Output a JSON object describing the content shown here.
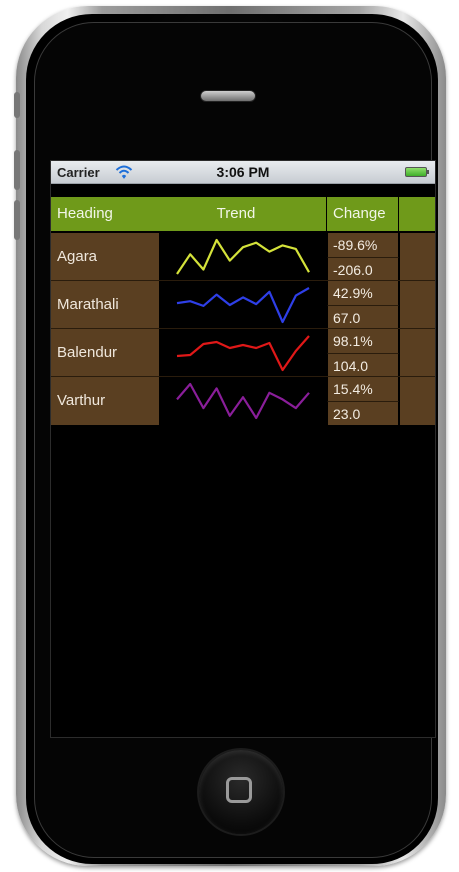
{
  "status_bar": {
    "carrier": "Carrier",
    "time": "3:06 PM",
    "wifi_icon": "wifi-icon",
    "battery_icon": "battery-icon"
  },
  "table": {
    "headers": {
      "heading": "Heading",
      "trend": "Trend",
      "change": "Change"
    },
    "rows": [
      {
        "name": "Agara",
        "change_percent": "-89.6%",
        "change_value": "-206.0",
        "trend_color": "#d4e23a",
        "trend": [
          5,
          2.8,
          4.5,
          1.2,
          3.5,
          2.0,
          1.5,
          2.5,
          1.8,
          2.2,
          4.8
        ]
      },
      {
        "name": "Marathali",
        "change_percent": "42.9%",
        "change_value": "67.0",
        "trend_color": "#2e3fe8",
        "trend": [
          3.2,
          3.0,
          3.5,
          2.3,
          3.4,
          2.6,
          3.3,
          2.0,
          5.2,
          2.4,
          1.6
        ]
      },
      {
        "name": "Balendur",
        "change_percent": "98.1%",
        "change_value": "104.0",
        "trend_color": "#e01818",
        "trend": [
          2.6,
          2.5,
          1.4,
          1.2,
          1.8,
          1.5,
          1.8,
          1.3,
          4.0,
          2.1,
          0.6
        ]
      },
      {
        "name": "Varthur",
        "change_percent": "15.4%",
        "change_value": "23.0",
        "trend_color": "#8a1e9a",
        "trend": [
          2.6,
          1.2,
          3.4,
          1.6,
          4.1,
          2.4,
          4.3,
          2.0,
          2.6,
          3.4,
          2.0
        ]
      }
    ]
  }
}
